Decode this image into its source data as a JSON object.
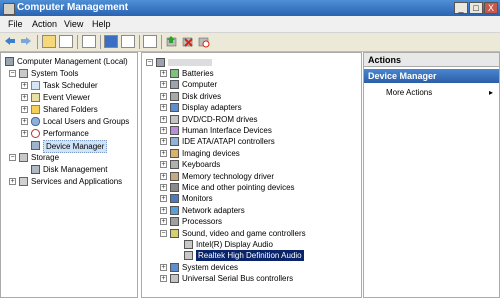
{
  "window": {
    "title": "Computer Management",
    "min_label": "_",
    "max_label": "□",
    "close_label": "X"
  },
  "menu": {
    "file": "File",
    "action": "Action",
    "view": "View",
    "help": "Help"
  },
  "toolbar": {
    "icons": [
      "back-icon",
      "forward-icon",
      "up-icon",
      "show-hide-tree-icon",
      "properties-icon",
      "help-icon",
      "view-icon",
      "scan-hardware-icon",
      "update-driver-icon",
      "uninstall-icon",
      "disable-icon"
    ]
  },
  "left_tree": {
    "root": "Computer Management (Local)",
    "system_tools": "System Tools",
    "task_scheduler": "Task Scheduler",
    "event_viewer": "Event Viewer",
    "shared_folders": "Shared Folders",
    "local_users": "Local Users and Groups",
    "performance": "Performance",
    "device_manager": "Device Manager",
    "storage": "Storage",
    "disk_management": "Disk Management",
    "services": "Services and Applications"
  },
  "device_tree": {
    "root": "",
    "items": [
      "Batteries",
      "Computer",
      "Disk drives",
      "Display adapters",
      "DVD/CD-ROM drives",
      "Human Interface Devices",
      "IDE ATA/ATAPI controllers",
      "Imaging devices",
      "Keyboards",
      "Memory technology driver",
      "Mice and other pointing devices",
      "Monitors",
      "Network adapters",
      "Processors",
      "Sound, video and game controllers"
    ],
    "sound_children": [
      "Intel(R) Display Audio",
      "Realtek High Definition Audio"
    ],
    "after_items": [
      "System devices",
      "Universal Serial Bus controllers"
    ]
  },
  "actions": {
    "header": "Actions",
    "section": "Device Manager",
    "more": "More Actions",
    "more_arrow": "▸"
  }
}
